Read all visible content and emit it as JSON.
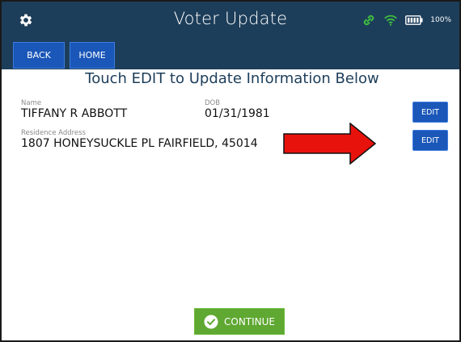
{
  "header": {
    "title": "Voter Update",
    "battery_percent": "100%",
    "back_label": "BACK",
    "home_label": "HOME"
  },
  "instruction": "Touch EDIT to Update Information Below",
  "voter": {
    "name_label": "Name",
    "name_value": "TIFFANY R ABBOTT",
    "dob_label": "DOB",
    "dob_value": "01/31/1981",
    "address_label": "Residence Address",
    "address_value": "1807 HONEYSUCKLE PL FAIRFIELD, 45014"
  },
  "edit_labels": [
    "EDIT",
    "EDIT"
  ],
  "continue_label": "CONTINUE",
  "colors": {
    "header_bg": "#1d3e5a",
    "button_blue": "#1a57b8",
    "continue_green": "#5fa832",
    "arrow_red": "#e8120c",
    "link_green": "#3fbf3f"
  },
  "icons": [
    "gear-icon",
    "link-icon",
    "wifi-icon",
    "battery-icon",
    "arrow-icon",
    "check-circle-icon"
  ]
}
